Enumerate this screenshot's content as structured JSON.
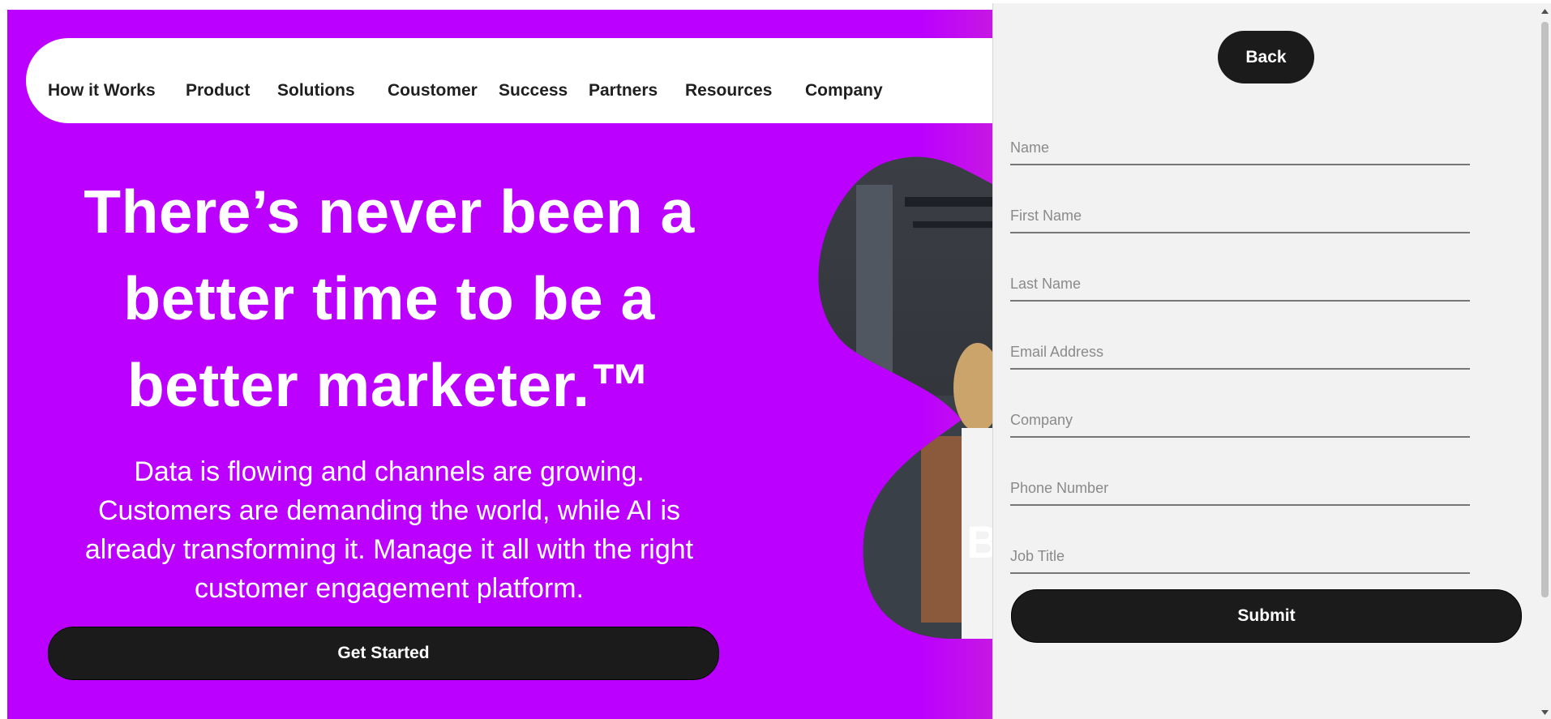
{
  "nav": {
    "items": [
      {
        "label": "How it Works"
      },
      {
        "label": "Product"
      },
      {
        "label": "Solutions"
      },
      {
        "label": "Coustomer"
      },
      {
        "label": "Success"
      },
      {
        "label": "Partners"
      },
      {
        "label": "Resources"
      },
      {
        "label": "Company"
      }
    ]
  },
  "hero": {
    "headline_line1": "There’s never been a",
    "headline_line2": "better time to be a",
    "headline_line3": "better marketer.™",
    "subtext_line1": "Data is flowing and channels are growing.",
    "subtext_line2": "Customers are demanding the world, while AI is",
    "subtext_line3": "already transforming it. Manage it all with the right",
    "subtext_line4": "customer engagement platform.",
    "cta_label": "Get Started",
    "photo_letter": "B"
  },
  "form": {
    "back_label": "Back",
    "fields": [
      {
        "placeholder": "Name"
      },
      {
        "placeholder": "First Name"
      },
      {
        "placeholder": "Last Name"
      },
      {
        "placeholder": "Email Address"
      },
      {
        "placeholder": "Company"
      },
      {
        "placeholder": "Phone Number"
      },
      {
        "placeholder": "Job Title"
      }
    ],
    "submit_label": "Submit"
  },
  "colors": {
    "brand_purple": "#bb00ff",
    "button_dark": "#1b1b1b",
    "panel_bg": "#f2f2f2"
  },
  "icons": [
    "scroll-up-arrow-icon",
    "scroll-down-arrow-icon"
  ]
}
